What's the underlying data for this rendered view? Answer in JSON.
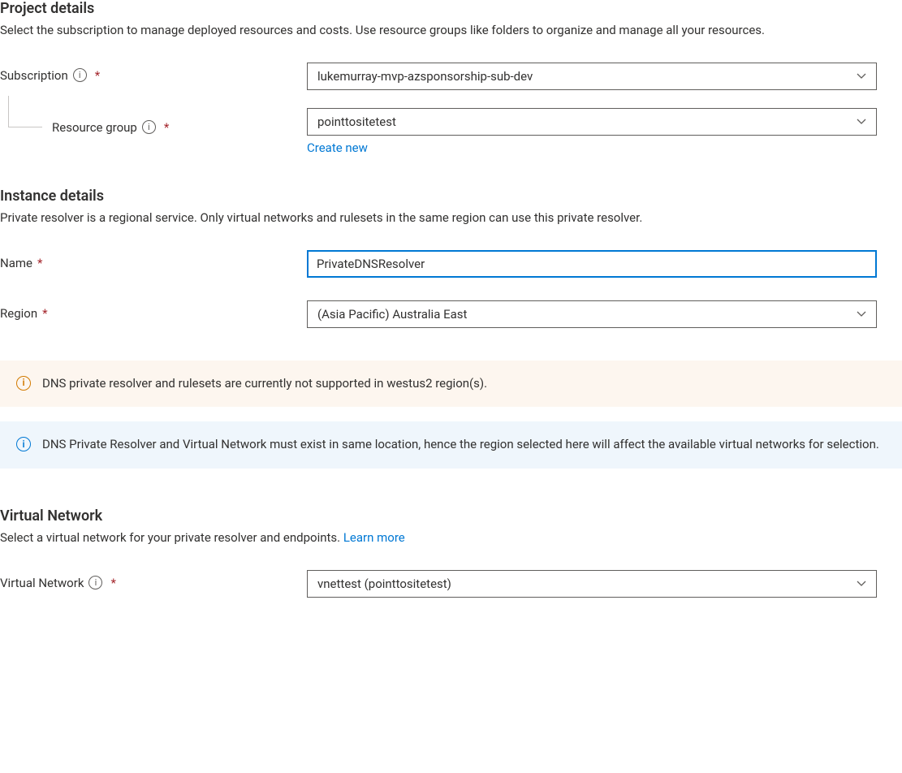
{
  "projectDetails": {
    "title": "Project details",
    "description": "Select the subscription to manage deployed resources and costs. Use resource groups like folders to organize and manage all your resources.",
    "subscriptionLabel": "Subscription",
    "subscriptionValue": "lukemurray-mvp-azsponsorship-sub-dev",
    "resourceGroupLabel": "Resource group",
    "resourceGroupValue": "pointtositetest",
    "createNewLabel": "Create new"
  },
  "instanceDetails": {
    "title": "Instance details",
    "description": "Private resolver is a regional service. Only virtual networks and rulesets in the same region can use this private resolver.",
    "nameLabel": "Name",
    "nameValue": "PrivateDNSResolver",
    "regionLabel": "Region",
    "regionValue": "(Asia Pacific) Australia East"
  },
  "banners": {
    "warning": "DNS private resolver and rulesets are currently not supported in westus2 region(s).",
    "info": "DNS Private Resolver and Virtual Network must exist in same location, hence the region selected here will affect the available virtual networks for selection."
  },
  "virtualNetwork": {
    "title": "Virtual Network",
    "description": "Select a virtual network for your private resolver and endpoints. ",
    "learnMoreLabel": "Learn more",
    "label": "Virtual Network",
    "value": "vnettest (pointtositetest)"
  },
  "symbols": {
    "asterisk": "*",
    "infoGlyph": "i"
  }
}
